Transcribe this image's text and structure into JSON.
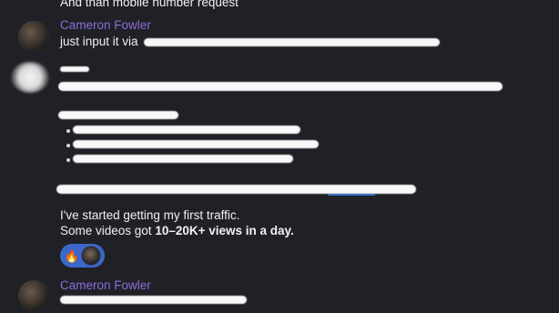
{
  "messages": [
    {
      "text": "And than mobile number request"
    },
    {
      "author": "Cameron Fowler",
      "text": "just input it via"
    },
    {
      "text_line1": "I've started getting my first traffic.",
      "text_line2_prefix": "Some videos got ",
      "text_line2_bold": "10–20K+ views in a day."
    },
    {
      "author": "Cameron Fowler"
    }
  ],
  "reactions": {
    "emoji": "🔥"
  },
  "colors": {
    "background": "#1f2127",
    "author": "#8f6cd8",
    "reaction_pill": "#3b67c9",
    "link": "#3d78d8"
  },
  "icons": {
    "reaction": "fire-emoji",
    "reactor_avatar": "user-avatar"
  }
}
